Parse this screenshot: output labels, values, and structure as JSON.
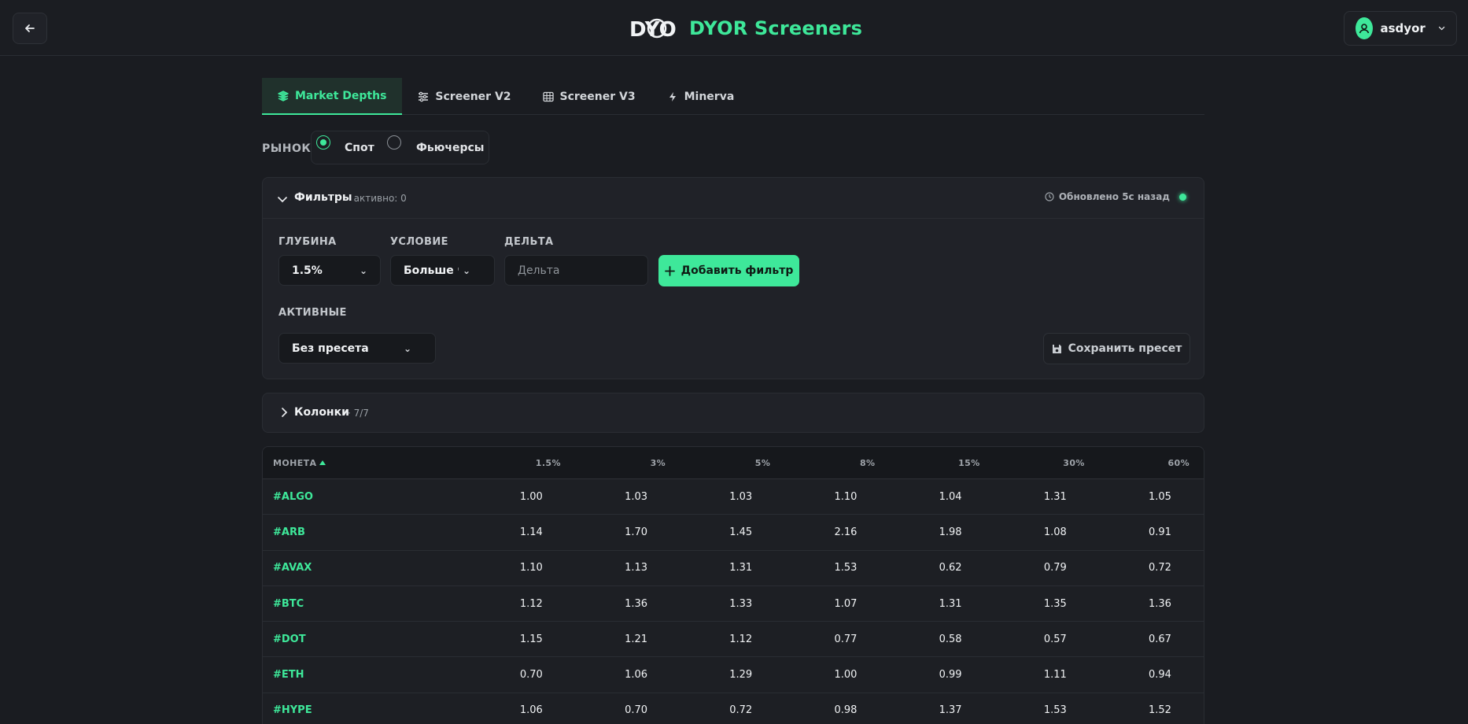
{
  "header": {
    "brand_logo_text": "DYOR",
    "brand_title": "DYOR Screeners",
    "user_name": "asdyor"
  },
  "tabs": [
    {
      "label": "Market Depths",
      "active": true,
      "icon": "layers-icon"
    },
    {
      "label": "Screener V2",
      "active": false,
      "icon": "sliders-icon"
    },
    {
      "label": "Screener V3",
      "active": false,
      "icon": "grid-icon"
    },
    {
      "label": "Minerva",
      "active": false,
      "icon": "bolt-icon"
    }
  ],
  "market": {
    "label": "РЫНОК",
    "options": [
      {
        "label": "Спот",
        "checked": true
      },
      {
        "label": "Фьючерсы",
        "checked": false
      }
    ]
  },
  "filters": {
    "title": "Фильтры",
    "active_count": "· активно: 0",
    "updated": "Обновлено 5с назад",
    "depth_label": "ГЛУБИНА",
    "depth_value": "1.5%",
    "condition_label": "УСЛОВИЕ",
    "condition_value": "Больше чем",
    "delta_label": "ДЕЛЬТА",
    "delta_placeholder": "Дельта",
    "add_filter": "Добавить фильтр",
    "active_label": "АКТИВНЫЕ",
    "preset_value": "Без пресета",
    "save_preset": "Сохранить пресет"
  },
  "columns": {
    "title": "Колонки",
    "count": "· 7/7"
  },
  "table": {
    "headers": [
      "МОНЕТА",
      "1.5%",
      "3%",
      "5%",
      "8%",
      "15%",
      "30%",
      "60%"
    ],
    "rows": [
      {
        "coin": "#ALGO",
        "v": [
          "1.00",
          "1.03",
          "1.03",
          "1.10",
          "1.04",
          "1.31",
          "1.05"
        ]
      },
      {
        "coin": "#ARB",
        "v": [
          "1.14",
          "1.70",
          "1.45",
          "2.16",
          "1.98",
          "1.08",
          "0.91"
        ]
      },
      {
        "coin": "#AVAX",
        "v": [
          "1.10",
          "1.13",
          "1.31",
          "1.53",
          "0.62",
          "0.79",
          "0.72"
        ]
      },
      {
        "coin": "#BTC",
        "v": [
          "1.12",
          "1.36",
          "1.33",
          "1.07",
          "1.31",
          "1.35",
          "1.36"
        ]
      },
      {
        "coin": "#DOT",
        "v": [
          "1.15",
          "1.21",
          "1.12",
          "0.77",
          "0.58",
          "0.57",
          "0.67"
        ]
      },
      {
        "coin": "#ETH",
        "v": [
          "0.70",
          "1.06",
          "1.29",
          "1.00",
          "0.99",
          "1.11",
          "0.94"
        ]
      },
      {
        "coin": "#HYPE",
        "v": [
          "1.06",
          "0.70",
          "0.72",
          "0.98",
          "1.37",
          "1.53",
          "1.52"
        ]
      }
    ]
  },
  "colors": {
    "accent": "#3ee89a",
    "background": "#1a1c21",
    "panel": "#202228"
  }
}
